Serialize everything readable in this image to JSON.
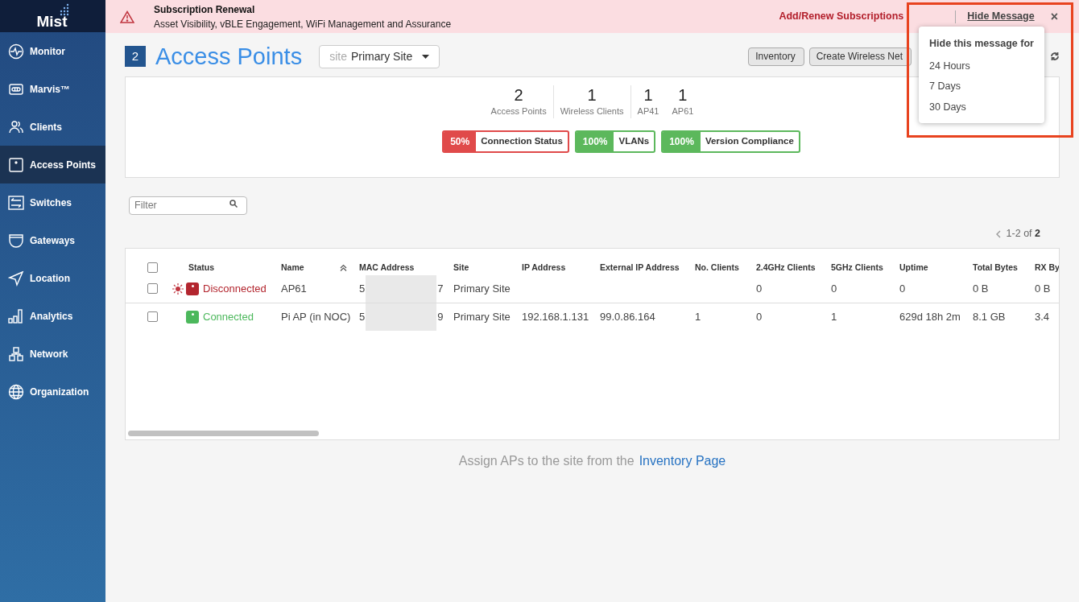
{
  "logo": {
    "text": "Mist"
  },
  "sidebar": {
    "items": [
      {
        "label": "Monitor",
        "selected": false
      },
      {
        "label": "Marvis™",
        "selected": false
      },
      {
        "label": "Clients",
        "selected": false
      },
      {
        "label": "Access Points",
        "selected": true
      },
      {
        "label": "Switches",
        "selected": false
      },
      {
        "label": "Gateways",
        "selected": false
      },
      {
        "label": "Location",
        "selected": false
      },
      {
        "label": "Analytics",
        "selected": false
      },
      {
        "label": "Network",
        "selected": false
      },
      {
        "label": "Organization",
        "selected": false
      }
    ]
  },
  "banner": {
    "title": "Subscription Renewal",
    "subtitle": "Asset Visibility, vBLE Engagement, WiFi Management and Assurance",
    "link": "Add/Renew Subscriptions",
    "hide_link": "Hide Message",
    "close": "×"
  },
  "popover": {
    "title": "Hide this message for",
    "options": [
      "24 Hours",
      "7 Days",
      "30 Days"
    ]
  },
  "header": {
    "count": "2",
    "title": "Access Points",
    "site_label": "site",
    "site_value": "Primary Site"
  },
  "toolbar": {
    "buttons": [
      "Inventory",
      "Create Wireless Net"
    ]
  },
  "stats": [
    {
      "value": "2",
      "label": "Access Points"
    },
    {
      "value": "1",
      "label": "Wireless Clients"
    },
    {
      "value": "1",
      "label": "AP41"
    },
    {
      "value": "1",
      "label": "AP61"
    }
  ],
  "badges": [
    {
      "percent": "50%",
      "label": "Connection Status",
      "color": "#e04a4a"
    },
    {
      "percent": "100%",
      "label": "VLANs",
      "color": "#5cb85c"
    },
    {
      "percent": "100%",
      "label": "Version Compliance",
      "color": "#5cb85c"
    }
  ],
  "filter": {
    "placeholder": "Filter"
  },
  "pager": {
    "range": "1-2 of",
    "total": "2"
  },
  "table": {
    "select_all_checked": false,
    "columns": [
      "Status",
      "Name",
      "MAC Address",
      "Site",
      "IP Address",
      "External IP Address",
      "No. Clients",
      "2.4GHz Clients",
      "5GHz Clients",
      "Uptime",
      "Total Bytes",
      "RX By"
    ],
    "rows": [
      {
        "checked": false,
        "alert": true,
        "status": "Disconnected",
        "kind": "disconnected",
        "name": "AP61",
        "mac_start": "5",
        "mac_end": "7",
        "site": "Primary Site",
        "ip": "",
        "external_ip": "",
        "clients": "",
        "clients_24": "0",
        "clients_5": "0",
        "uptime": "0",
        "total_bytes": "0 B",
        "rx_bytes": "0 B"
      },
      {
        "checked": false,
        "alert": false,
        "status": "Connected",
        "kind": "connected",
        "name": "Pi AP (in NOC)",
        "mac_start": "5",
        "mac_end": "9",
        "site": "Primary Site",
        "ip": "192.168.1.131",
        "external_ip": "99.0.86.164",
        "clients": "1",
        "clients_24": "0",
        "clients_5": "1",
        "uptime": "629d 18h 2m",
        "total_bytes": "8.1 GB",
        "rx_bytes": "3.4"
      }
    ]
  },
  "footer": {
    "text": "Assign APs to the site from the",
    "link": "Inventory Page"
  }
}
